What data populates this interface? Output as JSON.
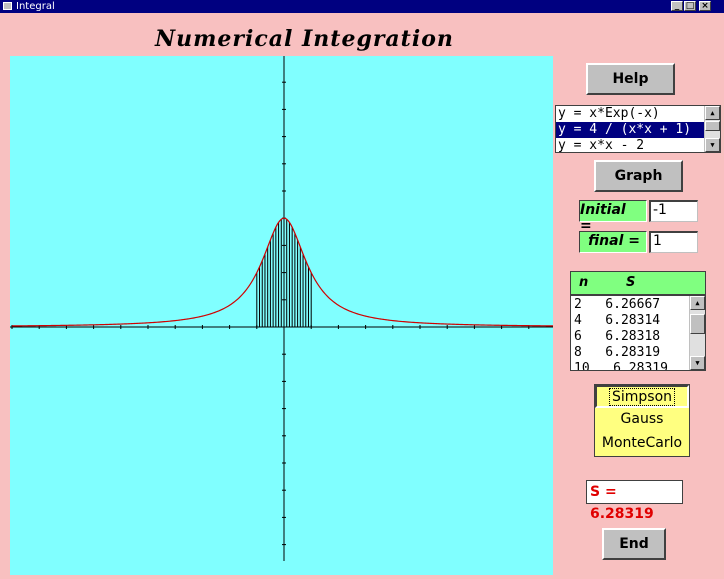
{
  "window": {
    "title": "Integral",
    "controls": {
      "minimize": "_",
      "maximize": "□",
      "close": "×"
    }
  },
  "app_title": "Numerical  Integration",
  "buttons": {
    "help": "Help",
    "graph": "Graph",
    "end": "End"
  },
  "functions": {
    "items": [
      "y = x*Exp(-x)",
      "y = 4 / (x*x + 1)",
      "y = x*x - 2"
    ],
    "selected_index": 1
  },
  "limits": {
    "initial_label": "Initial =",
    "initial_value": "-1",
    "final_label": "final =",
    "final_value": "1"
  },
  "results": {
    "header_n": "n",
    "header_s": "S",
    "rows": [
      "2   6.26667",
      "4   6.28314",
      "6   6.28318",
      "8   6.28319",
      "10   6.28319"
    ]
  },
  "methods": {
    "items": [
      "Simpson",
      "Gauss",
      "MonteCarlo"
    ],
    "selected": "Simpson"
  },
  "sum_display": "S = 6.28319",
  "plot": {
    "curve_color": "#d00000",
    "axis_color": "#000000",
    "background": "#80ffff",
    "function": "y = 4 / (x*x + 1)",
    "x_range": [
      -10,
      10
    ],
    "y_range": [
      -10,
      10
    ],
    "a": -1,
    "b": 1,
    "strips": 20
  }
}
